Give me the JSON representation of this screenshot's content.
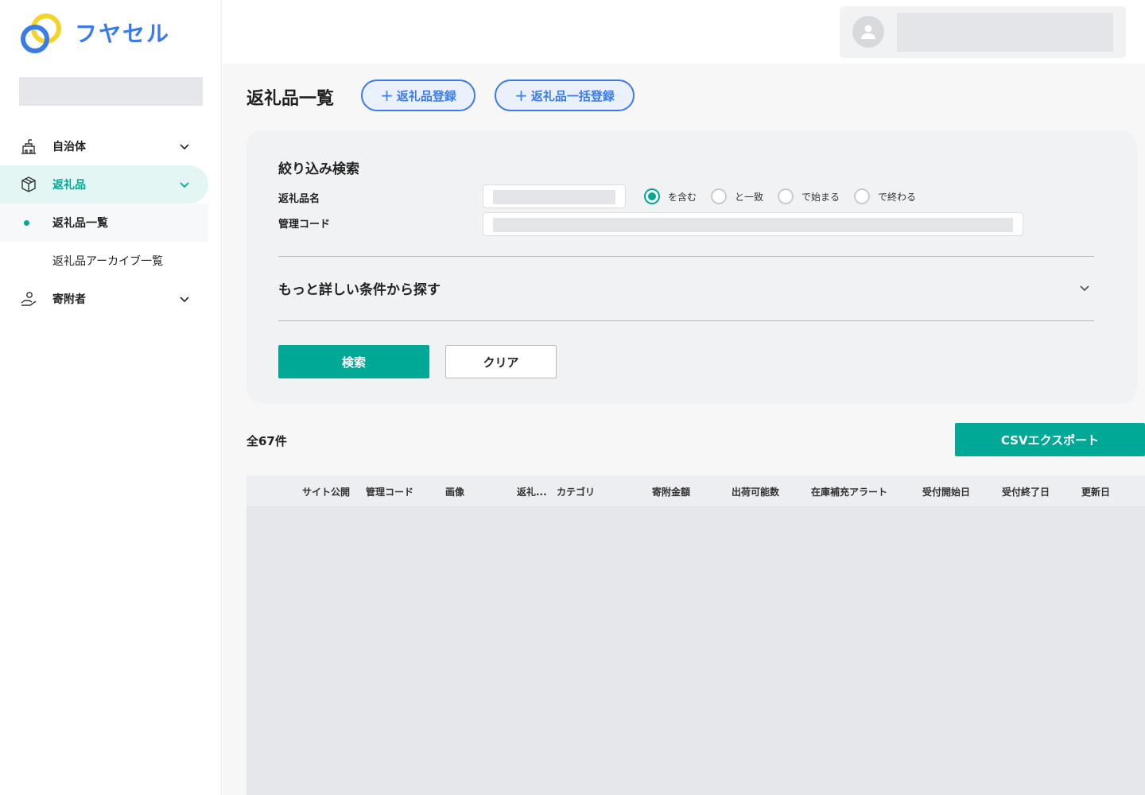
{
  "app": {
    "logo_text": "フヤセル",
    "brand_colors": {
      "primary": "#00a896",
      "accent": "#3b7be8",
      "logo_yellow": "#f5d327"
    }
  },
  "sidebar": {
    "items": [
      {
        "label": "自治体",
        "icon": "building-icon",
        "expanded": false
      },
      {
        "label": "返礼品",
        "icon": "package-icon",
        "expanded": true
      },
      {
        "label": "寄附者",
        "icon": "donor-hand-icon",
        "expanded": false
      }
    ],
    "subitems": [
      {
        "label": "返礼品一覧",
        "current": true
      },
      {
        "label": "返礼品アーカイブ一覧",
        "current": false
      }
    ]
  },
  "header": {
    "user_icon": "user-icon"
  },
  "page": {
    "title": "返礼品一覧",
    "register_button": "返礼品登録",
    "bulk_register_button": "返礼品一括登録",
    "plus_icon": "+"
  },
  "filter": {
    "title": "絞り込み検索",
    "name_label": "返礼品名",
    "code_label": "管理コード",
    "match_options": [
      "を含む",
      "と一致",
      "で始まる",
      "で終わる"
    ],
    "selected_match": "を含む",
    "advanced_label": "もっと詳しい条件から探す",
    "search_button": "検索",
    "clear_button": "クリア"
  },
  "results": {
    "total": "全67件",
    "csv_button": "CSVエクスポート"
  },
  "table": {
    "columns": [
      "サイト公開",
      "管理コード",
      "画像",
      "返礼...",
      "カテゴリ",
      "寄附金額",
      "出荷可能数",
      "在庫補充アラート",
      "受付開始日",
      "受付終了日",
      "更新日"
    ]
  }
}
